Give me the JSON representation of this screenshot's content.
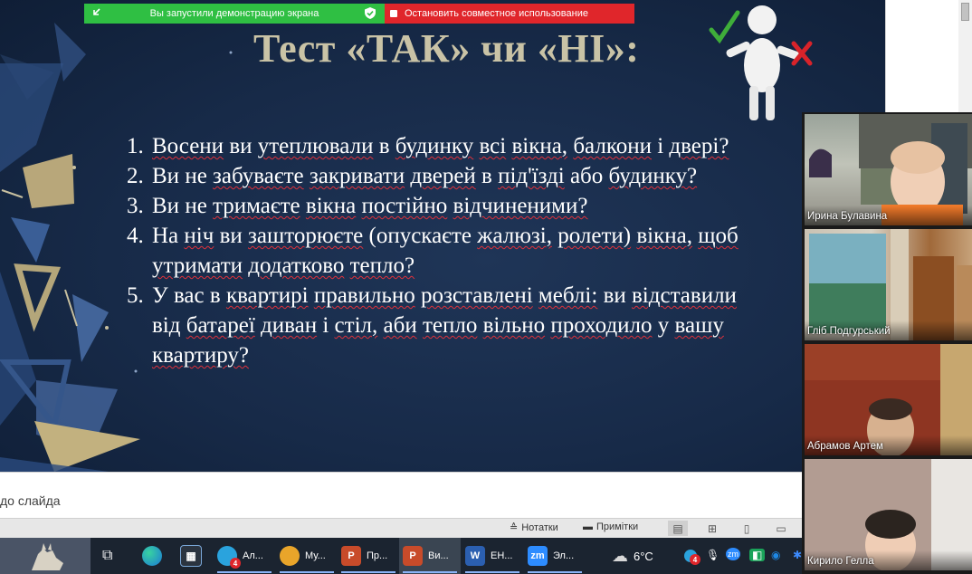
{
  "share_banner": {
    "status_text": "Вы запустили демонстрацию экрана",
    "stop_label": "Остановить совместное использование",
    "status_color": "#2fbf43",
    "stop_color": "#e0262b"
  },
  "slide": {
    "title": "Тест «ТАК» чи «НІ»:",
    "title_color": "#c9c3a6",
    "background_color": "#172a48",
    "questions": [
      {
        "num": "1.",
        "lines": [
          "Восени ви утеплювали в будинку всі вікна, балкони і двері?"
        ]
      },
      {
        "num": "2.",
        "lines": [
          "Ви не забуваєте закривати дверей в під'їзді або будинку?"
        ]
      },
      {
        "num": "3.",
        "lines": [
          "Ви не тримаєте вікна постійно відчиненими?"
        ]
      },
      {
        "num": "4.",
        "lines": [
          "На ніч ви зашторюєте (опускаєте жалюзі, ролети) вікна, щоб",
          "утримати додатково тепло?"
        ]
      },
      {
        "num": "5.",
        "lines": [
          "У вас в квартирі правильно розставлені меблі: ви відставили",
          "від батареї диван і стіл, аби тепло вільно проходило у вашу",
          "квартиру?"
        ]
      }
    ]
  },
  "notes": {
    "placeholder": "до слайда"
  },
  "status_bar": {
    "notes_label": "Нотатки",
    "comments_label": "Примітки"
  },
  "participants": [
    {
      "name": "Ирина Булавина"
    },
    {
      "name": "Гліб Подгурський"
    },
    {
      "name": "Абрамов Артем"
    },
    {
      "name": "Кирило Гелла"
    }
  ],
  "taskbar": {
    "apps": [
      {
        "id": "telegram",
        "label": "Ал...",
        "icon": "telegram-icon",
        "color": "#2aa3dd",
        "badge": "4"
      },
      {
        "id": "chrome",
        "label": "Му...",
        "icon": "chrome-icon",
        "color": "#e9a52a"
      },
      {
        "id": "powerpoint-1",
        "label": "Пр...",
        "icon": "powerpoint-icon",
        "color": "#c84b2a"
      },
      {
        "id": "powerpoint-2",
        "label": "Ви...",
        "icon": "powerpoint-icon",
        "color": "#c84b2a"
      },
      {
        "id": "word",
        "label": "ЕН...",
        "icon": "word-icon",
        "color": "#2b5fb0"
      },
      {
        "id": "zoom",
        "label": "Эл...",
        "icon": "zoom-icon",
        "color": "#2d8cff"
      }
    ],
    "weather": "6°C",
    "tray_badge": "4"
  }
}
